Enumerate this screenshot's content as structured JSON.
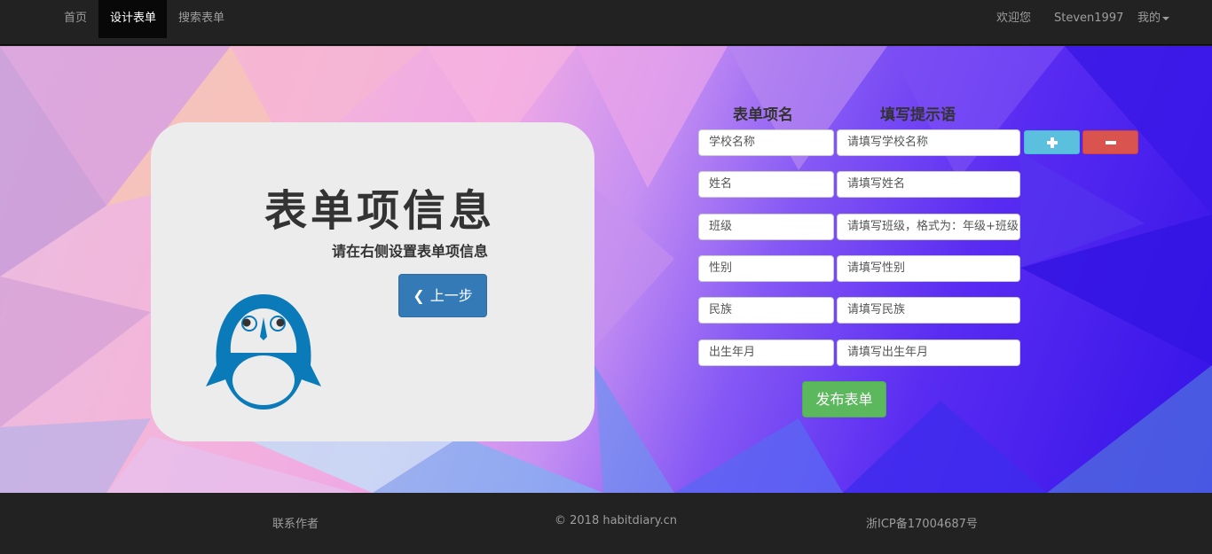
{
  "navbar": {
    "items": [
      {
        "label": "首页"
      },
      {
        "label": "设计表单",
        "active": true
      },
      {
        "label": "搜索表单"
      }
    ],
    "right": {
      "welcome": "欢迎您",
      "username": "Steven1997",
      "mine": "我的"
    }
  },
  "card": {
    "title": "表单项信息",
    "subtitle": "请在右侧设置表单项信息",
    "back_label": "上一步"
  },
  "form": {
    "header_name": "表单项名",
    "header_hint": "填写提示语",
    "rows": [
      {
        "name": "学校名称",
        "hint": "请填写学校名称"
      },
      {
        "name": "姓名",
        "hint": "请填写姓名"
      },
      {
        "name": "班级",
        "hint": "请填写班级，格式为：年级+班级"
      },
      {
        "name": "性别",
        "hint": "请填写性别"
      },
      {
        "name": "民族",
        "hint": "请填写民族"
      },
      {
        "name": "出生年月",
        "hint": "请填写出生年月"
      }
    ],
    "add_icon": "plus-icon",
    "remove_icon": "minus-icon",
    "publish_label": "发布表单"
  },
  "footer": {
    "contact": "联系作者",
    "copyright": "© 2018 habitdiary.cn",
    "icp": "浙ICP备17004687号"
  },
  "colors": {
    "navbar_bg": "#222222",
    "primary": "#337ab7",
    "info": "#5bc0de",
    "danger": "#d9534f",
    "success": "#5cb85c",
    "mascot_blue": "#0a7ab8"
  }
}
